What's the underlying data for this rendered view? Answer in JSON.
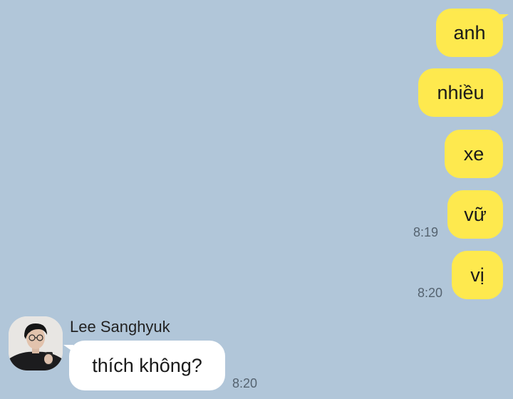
{
  "colors": {
    "background": "#b1c6d9",
    "outgoing_bubble": "#fee94e",
    "incoming_bubble": "#ffffff",
    "timestamp": "#556370"
  },
  "messages_out": [
    {
      "text": "anh"
    },
    {
      "text": "nhiều"
    },
    {
      "text": "xe"
    },
    {
      "text": "vữ",
      "time": "8:19"
    },
    {
      "text": "vị",
      "time": "8:20"
    }
  ],
  "incoming": {
    "sender_name": "Lee Sanghyuk",
    "avatar_icon": "profile-photo",
    "text": "thích không?",
    "time": "8:20"
  }
}
